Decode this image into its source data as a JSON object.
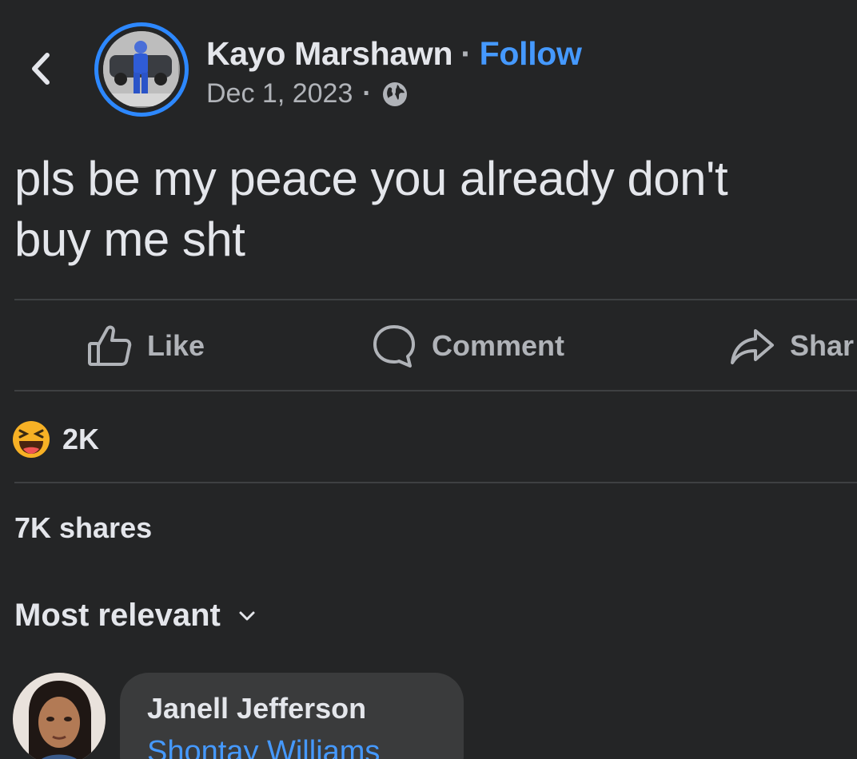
{
  "post": {
    "author": "Kayo Marshawn",
    "separator": "·",
    "follow_label": "Follow",
    "date": "Dec 1, 2023",
    "date_separator": "·",
    "privacy_icon": "globe-icon",
    "text": "pls be my peace you already don't\nbuy me sht"
  },
  "actions": {
    "like_label": "Like",
    "comment_label": "Comment",
    "share_label": "Shar"
  },
  "stats": {
    "reaction_icon": "haha-emoji-icon",
    "reaction_count": "2K",
    "shares": "7K shares"
  },
  "comments": {
    "sort_label": "Most relevant",
    "items": [
      {
        "author": "Janell Jefferson",
        "mention": "Shontay Williams"
      }
    ]
  },
  "colors": {
    "background": "#242526",
    "text_primary": "#e4e6eb",
    "text_secondary": "#b0b3b8",
    "link_blue": "#4599ff",
    "ring_blue": "#2d88ff",
    "bubble": "#3a3b3c",
    "divider": "#3e4042"
  }
}
